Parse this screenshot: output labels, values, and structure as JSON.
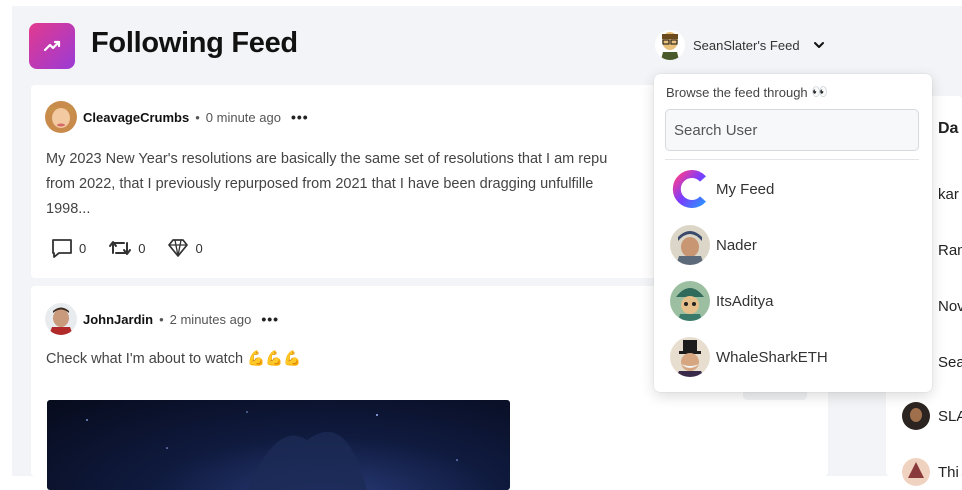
{
  "header": {
    "title": "Following Feed",
    "icon": "trending-up-icon",
    "feed_switcher_label": "SeanSlater's Feed"
  },
  "posts": [
    {
      "username": "CleavageCrumbs",
      "time": "0 minute ago",
      "text_lines": [
        "My 2023 New Year's resolutions are basically the same set of resolutions that I am repu",
        "from 2022, that I previously repurposed from 2021 that I have been dragging unfulfille",
        "1998..."
      ],
      "comments": "0",
      "reposts": "0",
      "diamonds": "0"
    },
    {
      "username": "JohnJardin",
      "time": "2 minutes ago",
      "text": "Check what I'm about to watch",
      "emoji": "💪💪💪"
    }
  ],
  "dropdown": {
    "caption": "Browse the feed through",
    "caption_emoji": "👀",
    "search_placeholder": "Search User",
    "items": [
      {
        "label": "My Feed"
      },
      {
        "label": "Nader"
      },
      {
        "label": "ItsAditya"
      },
      {
        "label": "WhaleSharkETH"
      }
    ]
  },
  "right_panel": {
    "heading": "Da",
    "items": [
      "kar",
      "Ran",
      "Nov",
      "Sea",
      "SLA",
      "Thi"
    ]
  },
  "separator_dot": "•",
  "more_glyph": "•••",
  "colors": {
    "accent_gradient_start": "#e23a8e",
    "accent_gradient_end": "#9b3bd6",
    "page_background": "#f2f4f7"
  }
}
